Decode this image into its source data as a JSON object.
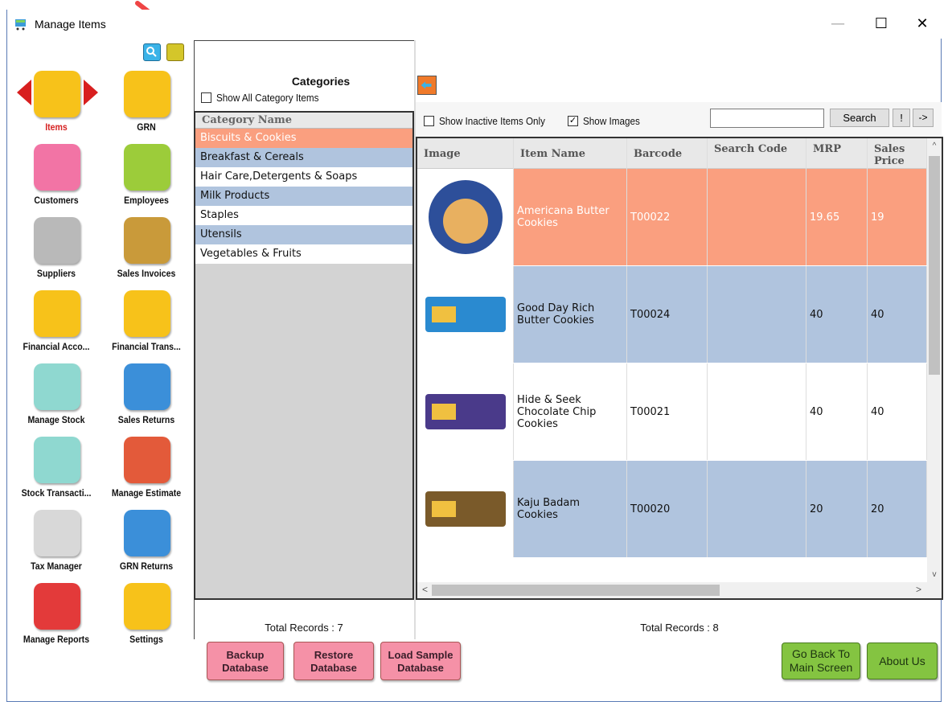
{
  "window": {
    "title": "Manage Items",
    "min": "—",
    "max": "☐",
    "close": "✕"
  },
  "nav": [
    {
      "id": "items",
      "label": "Items",
      "active": true,
      "color": "#f7c21a"
    },
    {
      "id": "grn",
      "label": "GRN",
      "color": "#f7c21a"
    },
    {
      "id": "customers",
      "label": "Customers",
      "color": "#f274a5"
    },
    {
      "id": "employees",
      "label": "Employees",
      "color": "#9ccc3a"
    },
    {
      "id": "suppliers",
      "label": "Suppliers",
      "color": "#b9b9b9"
    },
    {
      "id": "sales-invoices",
      "label": "Sales Invoices",
      "color": "#c99a3a"
    },
    {
      "id": "financial-accounts",
      "label": "Financial Acco...",
      "color": "#f7c21a"
    },
    {
      "id": "financial-transactions",
      "label": "Financial Trans...",
      "color": "#f7c21a"
    },
    {
      "id": "manage-stock",
      "label": "Manage Stock",
      "color": "#8fd8d0"
    },
    {
      "id": "sales-returns",
      "label": "Sales Returns",
      "color": "#3b8fd9"
    },
    {
      "id": "stock-transactions",
      "label": "Stock Transacti...",
      "color": "#8fd8d0"
    },
    {
      "id": "manage-estimate",
      "label": "Manage Estimate",
      "color": "#e35a3a"
    },
    {
      "id": "tax-manager",
      "label": "Tax Manager",
      "color": "#d8d8d8"
    },
    {
      "id": "grn-returns",
      "label": "GRN Returns",
      "color": "#3b8fd9"
    },
    {
      "id": "manage-reports",
      "label": "Manage Reports",
      "color": "#e33a3a"
    },
    {
      "id": "settings",
      "label": "Settings",
      "color": "#f7c21a"
    }
  ],
  "categories": {
    "title": "Categories",
    "show_all": "Show All Category Items",
    "header": "Category Name",
    "items": [
      "Biscuits & Cookies",
      "Breakfast & Cereals",
      "Hair Care,Detergents & Soaps",
      "Milk Products",
      "Staples",
      "Utensils",
      "Vegetables & Fruits"
    ],
    "total": "Total Records : 7"
  },
  "items": {
    "show_inactive": "Show Inactive Items Only",
    "show_images": "Show Images",
    "search_value": "",
    "search_label": "Search",
    "bang": "!",
    "arrow": "->",
    "columns": [
      "Image",
      "Item Name",
      "Barcode",
      "Search Code",
      "MRP",
      "Sales Price"
    ],
    "rows": [
      {
        "name": "Americana Butter Cookies",
        "barcode": "T00022",
        "search": "",
        "mrp": "19.65",
        "sales": "19"
      },
      {
        "name": "Good Day Rich Butter Cookies",
        "barcode": "T00024",
        "search": "",
        "mrp": "40",
        "sales": "40"
      },
      {
        "name": "Hide & Seek Chocolate Chip Cookies",
        "barcode": "T00021",
        "search": "",
        "mrp": "40",
        "sales": "40"
      },
      {
        "name": "Kaju Badam Cookies",
        "barcode": "T00020",
        "search": "",
        "mrp": "20",
        "sales": "20"
      }
    ],
    "total": "Total Records : 8"
  },
  "footer": {
    "backup": "Backup Database",
    "restore": "Restore Database",
    "load_sample": "Load Sample Database",
    "go_back": "Go Back To Main Screen",
    "about": "About Us"
  }
}
